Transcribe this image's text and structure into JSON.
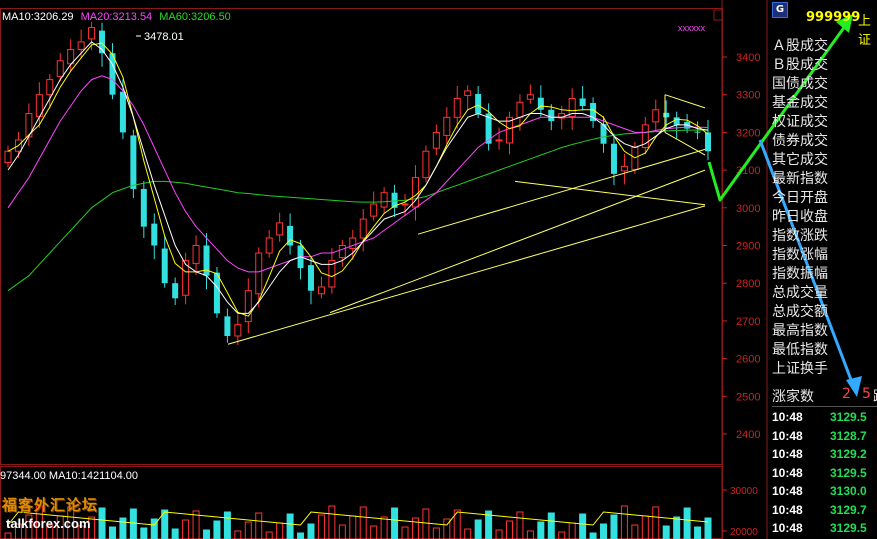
{
  "chart_data": {
    "type": "candlestick",
    "ma_legend": [
      {
        "label": "MA10:3206.29",
        "color": "#ffffff"
      },
      {
        "label": "MA20:3213.54",
        "color": "#ff44ff"
      },
      {
        "label": "MA60:3206.50",
        "color": "#22dd22"
      }
    ],
    "peak_label": "3478.01",
    "y_ticks": [
      3400,
      3300,
      3200,
      3100,
      3000,
      2900,
      2800,
      2700,
      2600,
      2500,
      2400
    ],
    "volume_legend": "97344.00  MA10:1421104.00",
    "volume_ticks": [
      "30000",
      "20000"
    ],
    "close_series": [
      3150,
      3180,
      3250,
      3300,
      3340,
      3390,
      3420,
      3440,
      3478,
      3410,
      3300,
      3200,
      3050,
      2950,
      2900,
      2800,
      2760,
      2860,
      2900,
      2820,
      2720,
      2660,
      2690,
      2780,
      2880,
      2920,
      2960,
      2900,
      2840,
      2780,
      2790,
      2860,
      2900,
      2920,
      2970,
      3010,
      3040,
      3000,
      3010,
      3080,
      3150,
      3200,
      3240,
      3290,
      3310,
      3250,
      3170,
      3180,
      3240,
      3280,
      3300,
      3260,
      3230,
      3250,
      3290,
      3270,
      3230,
      3170,
      3090,
      3110,
      3160,
      3220,
      3260,
      3240,
      3220,
      3210,
      3200,
      3150
    ],
    "ma10": [
      3100,
      3140,
      3190,
      3240,
      3290,
      3340,
      3380,
      3410,
      3440,
      3420,
      3380,
      3320,
      3240,
      3150,
      3060,
      2980,
      2900,
      2850,
      2830,
      2820,
      2790,
      2750,
      2720,
      2720,
      2750,
      2790,
      2830,
      2860,
      2870,
      2860,
      2850,
      2850,
      2860,
      2880,
      2910,
      2940,
      2970,
      2980,
      2990,
      3020,
      3060,
      3110,
      3160,
      3200,
      3240,
      3250,
      3240,
      3230,
      3230,
      3240,
      3250,
      3250,
      3240,
      3240,
      3250,
      3250,
      3240,
      3220,
      3190,
      3170,
      3160,
      3170,
      3190,
      3210,
      3220,
      3220,
      3210,
      3206
    ],
    "ma20": [
      3000,
      3040,
      3080,
      3130,
      3180,
      3230,
      3270,
      3310,
      3340,
      3350,
      3340,
      3310,
      3270,
      3220,
      3160,
      3100,
      3040,
      2990,
      2950,
      2920,
      2890,
      2860,
      2840,
      2830,
      2830,
      2840,
      2850,
      2860,
      2870,
      2870,
      2880,
      2880,
      2890,
      2900,
      2910,
      2920,
      2940,
      2960,
      2980,
      3000,
      3020,
      3040,
      3070,
      3100,
      3130,
      3160,
      3180,
      3200,
      3210,
      3220,
      3230,
      3240,
      3240,
      3240,
      3240,
      3240,
      3240,
      3230,
      3220,
      3210,
      3200,
      3200,
      3205,
      3210,
      3212,
      3214,
      3214,
      3213
    ],
    "ma60": [
      2780,
      2800,
      2820,
      2850,
      2880,
      2910,
      2940,
      2970,
      3000,
      3020,
      3040,
      3050,
      3060,
      3065,
      3070,
      3070,
      3068,
      3065,
      3060,
      3055,
      3050,
      3045,
      3040,
      3038,
      3035,
      3032,
      3030,
      3028,
      3026,
      3024,
      3022,
      3020,
      3018,
      3016,
      3015,
      3015,
      3016,
      3018,
      3020,
      3024,
      3030,
      3040,
      3050,
      3060,
      3070,
      3080,
      3090,
      3100,
      3110,
      3120,
      3130,
      3140,
      3150,
      3160,
      3168,
      3175,
      3182,
      3188,
      3192,
      3196,
      3198,
      3200,
      3202,
      3204,
      3205,
      3206,
      3206,
      3206
    ]
  },
  "sidebar": {
    "header_code": "999999",
    "header_name": "上证",
    "g_label": "G",
    "menu": [
      "Ａ股成交",
      "Ｂ股成交",
      "国债成交",
      "基金成交",
      "权证成交",
      "债券成交",
      "其它成交",
      "最新指数",
      "今日开盘",
      "昨日收盘",
      "指数涨跌",
      "指数涨幅",
      "指数振幅",
      "总成交量",
      "总成交额",
      "最高指数",
      "最低指数",
      "上证换手"
    ],
    "rise_label": "涨家数",
    "rise_value": "2",
    "rise_value2": "5",
    "rise_suffix": "跌",
    "ticks": [
      {
        "time": "10:48",
        "price": "3129.5"
      },
      {
        "time": "10:48",
        "price": "3128.7"
      },
      {
        "time": "10:48",
        "price": "3129.2"
      },
      {
        "time": "10:48",
        "price": "3129.5"
      },
      {
        "time": "10:48",
        "price": "3130.0"
      },
      {
        "time": "10:48",
        "price": "3129.7"
      },
      {
        "time": "10:48",
        "price": "3129.5"
      }
    ]
  },
  "watermark": {
    "cn": "福客外汇论坛",
    "en": "talkforex.com"
  },
  "colors": {
    "up": "#ff3333",
    "down": "#33e0e0",
    "ma10": "#ffffff",
    "ma20": "#ff44ff",
    "ma60": "#22cc22",
    "ma5": "#ffff00",
    "trend": "#ffff66",
    "arrow_green": "#22ee22",
    "arrow_blue": "#33aaff"
  }
}
